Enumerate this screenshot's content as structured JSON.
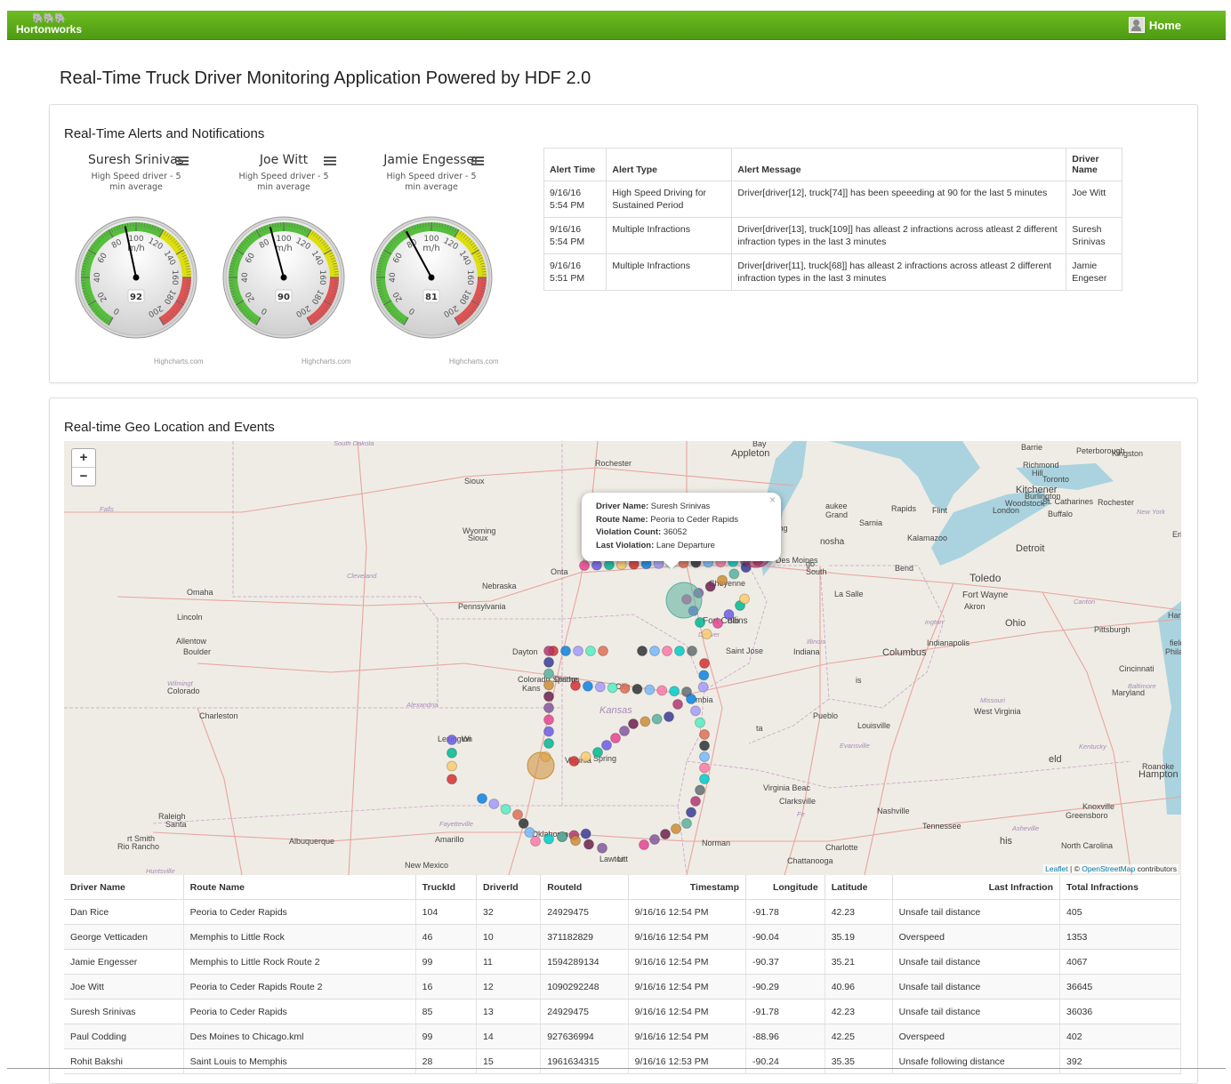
{
  "header": {
    "brand": "Hortonworks",
    "home_label": "Home"
  },
  "page_title": "Real-Time Truck Driver Monitoring Application Powered by HDF 2.0",
  "alerts_panel": {
    "title": "Real-Time Alerts and Notifications",
    "gauge_credit": "Highcharts.com",
    "gauges": [
      {
        "driver": "Suresh Srinivas",
        "subtitle_1": "High Speed driver - 5",
        "subtitle_2": "min average",
        "value": 92,
        "unit": "m/h"
      },
      {
        "driver": "Joe Witt",
        "subtitle_1": "High Speed driver - 5",
        "subtitle_2": "min average",
        "value": 90,
        "unit": "m/h"
      },
      {
        "driver": "Jamie Engesser",
        "subtitle_1": "High Speed driver - 5",
        "subtitle_2": "min average",
        "value": 81,
        "unit": "m/h"
      }
    ],
    "gauge_ticks": [
      "0",
      "20",
      "40",
      "60",
      "80",
      "100",
      "120",
      "140",
      "160",
      "180",
      "200"
    ],
    "table": {
      "headers": [
        "Alert Time",
        "Alert Type",
        "Alert Message",
        "Driver Name"
      ],
      "rows": [
        [
          "9/16/16 5:54 PM",
          "High Speed Driving for Sustained Period",
          "Driver[driver[12], truck[74]] has been speeeding at 90 for the last 5 minutes",
          "Joe Witt"
        ],
        [
          "9/16/16 5:54 PM",
          "Multiple Infractions",
          "Driver[driver[13], truck[109]] has alleast 2 infractions across atleast 2 different infraction types in the last 3 minutes",
          "Suresh Srinivas"
        ],
        [
          "9/16/16 5:51 PM",
          "Multiple Infractions",
          "Driver[driver[11], truck[68]] has alleast 2 infractions across atleast 2 different infraction types in the last 3 minutes",
          "Jamie Engeser"
        ]
      ]
    }
  },
  "geo_panel": {
    "title": "Real-time Geo Location and Events",
    "zoom_in": "+",
    "zoom_out": "−",
    "popup": {
      "driver_label": "Driver Name:",
      "driver": "Suresh Srinivas",
      "route_label": "Route Name:",
      "route": "Peoria to Ceder Rapids",
      "count_label": "Violation Count:",
      "count": "36052",
      "last_label": "Last Violation:",
      "last": "Lane Departure",
      "close": "×"
    },
    "attribution": {
      "leaflet": "Leaflet",
      "sep": " | © ",
      "osm": "OpenStreetMap",
      "rest": " contributors"
    },
    "cities": [
      "South Dakota",
      "Bay",
      "Appleton",
      "Barrie",
      "Peterborough",
      "Kingston",
      "Rochester",
      "Richmond",
      "Hill",
      "Toronto",
      "Kitchener",
      "Burlington",
      "Woodstock",
      "St. Catharines",
      "Rochester",
      "London",
      "Buffalo",
      "New York",
      "Sioux",
      "Falls",
      "Wyoming",
      "Sioux",
      "City",
      "aukee",
      "Grand",
      "Rapids",
      "Flint",
      "Sarnia",
      "Lansing",
      "nosha",
      "Kalamazoo",
      "Detroit",
      "Erie",
      "Onta",
      "Des Moines",
      "go",
      "South",
      "Bend",
      "Toledo",
      "Cleveland",
      "Nebraska",
      "Omaha",
      "Cheyenne",
      "La Salle",
      "Fort Wayne",
      "Akron",
      "Canton",
      "Pennsylvania",
      "Lincoln",
      "Fort Collins",
      "Blo",
      "ington",
      "Ohio",
      "Pittsburgh",
      "Harrisburg",
      "Allentow",
      "Boulder",
      "Denver",
      "Illinois",
      "Indiana",
      "Indianapolis",
      "Columbus",
      "Dayton",
      "Saint Jose",
      "field",
      "Philad",
      "Wilmingt",
      "Colorado",
      "Colorado Springs",
      "Kans",
      "Olathe",
      "City",
      "mbia",
      "is",
      "Cincinnati",
      "Baltimore",
      "Maryland",
      "Alexandria",
      "Kansas",
      "Missouri",
      "West Virginia",
      "Charleston",
      "Pueblo",
      "Louisville",
      "Lexington",
      "Wi",
      "ta",
      "Evansville",
      "Kentucky",
      "Virginia",
      "Spring",
      "eld",
      "Roanoke",
      "Hampton",
      "Virginia Beac",
      "Clarksville",
      "Nashville",
      "Knoxville",
      "Greensboro",
      "Raleigh",
      "Santa",
      "Fe",
      "Tennessee",
      "Asheville",
      "North Carolina",
      "Fayetteville",
      "Oklahoma",
      "rt Smith",
      "Rio Rancho",
      "Albuquerque",
      "Amarillo",
      "Norman",
      "his",
      "Charlotte",
      "Chattanooga",
      "Huntsville",
      "New Mexico",
      "Lawton",
      "Litt",
      "ck"
    ]
  },
  "drivers_table": {
    "headers": [
      "Driver Name",
      "Route Name",
      "TruckId",
      "DriverId",
      "RouteId",
      "Timestamp",
      "Longitude",
      "Latitude",
      "Last Infraction",
      "Total Infractions"
    ],
    "rows": [
      [
        "Dan Rice",
        "Peoria to Ceder Rapids",
        "104",
        "32",
        "24929475",
        "9/16/16 12:54 PM",
        "-91.78",
        "42.23",
        "Unsafe tail distance",
        "405"
      ],
      [
        "George Vetticaden",
        "Memphis to Little Rock",
        "46",
        "10",
        "371182829",
        "9/16/16 12:54 PM",
        "-90.04",
        "35.19",
        "Overspeed",
        "1353"
      ],
      [
        "Jamie Engesser",
        "Memphis to Little Rock Route 2",
        "99",
        "11",
        "1594289134",
        "9/16/16 12:54 PM",
        "-90.37",
        "35.21",
        "Unsafe tail distance",
        "4067"
      ],
      [
        "Joe Witt",
        "Peoria to Ceder Rapids Route 2",
        "16",
        "12",
        "1090292248",
        "9/16/16 12:54 PM",
        "-90.29",
        "40.96",
        "Unsafe tail distance",
        "36645"
      ],
      [
        "Suresh Srinivas",
        "Peoria to Ceder Rapids",
        "85",
        "13",
        "24929475",
        "9/16/16 12:54 PM",
        "-91.78",
        "42.23",
        "Unsafe tail distance",
        "36036"
      ],
      [
        "Paul Codding",
        "Des Moines to Chicago.kml",
        "99",
        "14",
        "927636994",
        "9/16/16 12:54 PM",
        "-88.96",
        "42.25",
        "Overspeed",
        "402"
      ],
      [
        "Rohit Bakshi",
        "Saint Louis to Memphis",
        "28",
        "15",
        "1961634315",
        "9/16/16 12:53 PM",
        "-90.24",
        "35.35",
        "Unsafe following distance",
        "392"
      ]
    ]
  },
  "colors": {
    "brand_green": "#5aa919",
    "gauge_green": "#55bf3b",
    "gauge_yellow": "#dddf0d",
    "gauge_red": "#df5353",
    "lake": "#aad3df",
    "link": "#0078a8"
  }
}
